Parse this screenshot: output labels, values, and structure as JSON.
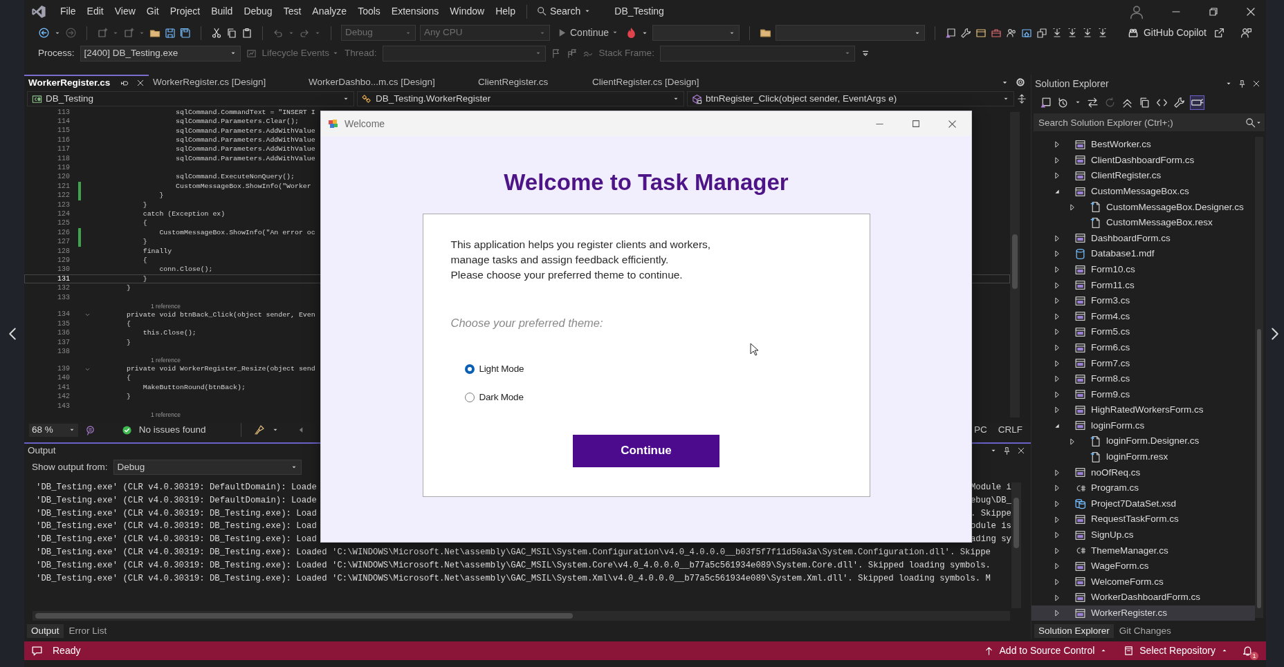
{
  "window": {
    "title": "DB_Testing"
  },
  "menu": [
    "File",
    "Edit",
    "View",
    "Git",
    "Project",
    "Build",
    "Debug",
    "Test",
    "Analyze",
    "Tools",
    "Extensions",
    "Window",
    "Help"
  ],
  "search": {
    "label": "Search"
  },
  "toolbar": {
    "dropdowns": [
      {
        "value": "Debug",
        "disabled": true
      },
      {
        "value": "Any CPU",
        "disabled": true
      }
    ],
    "continue": "Continue",
    "copilot": "GitHub Copilot"
  },
  "debug_bar": {
    "process_label": "Process:",
    "process": "[2400] DB_Testing.exe",
    "lifecycle_events": {
      "text": "Lifecycle Events",
      "disabled": true
    },
    "thread_label": {
      "text": "Thread:",
      "disabled": true
    },
    "stack_frame_label": {
      "text": "Stack Frame:",
      "disabled": true
    }
  },
  "document_tabs": [
    {
      "label": "WorkerRegister.cs",
      "selected": true
    },
    {
      "label": "WorkerRegister.cs [Design]",
      "selected": false
    },
    {
      "label": "WorkerDashbo...m.cs [Design]",
      "selected": false
    },
    {
      "label": "ClientRegister.cs",
      "selected": false
    },
    {
      "label": "ClientRegister.cs [Design]",
      "selected": false
    }
  ],
  "navigation_bar": [
    "DB_Testing",
    "DB_Testing.WorkerRegister",
    "btnRegister_Click(object sender, EventArgs e)"
  ],
  "code_lines": [
    {
      "kind": "code",
      "number": "113",
      "text": "            sqlCommand.CommandText = \"INSERT I",
      "changed": false,
      "current": false,
      "foldable": false
    },
    {
      "kind": "code",
      "number": "114",
      "text": "            sqlCommand.Parameters.Clear();",
      "changed": false,
      "current": false,
      "foldable": false
    },
    {
      "kind": "code",
      "number": "115",
      "text": "            sqlCommand.Parameters.AddWithValue",
      "changed": false,
      "current": false,
      "foldable": false
    },
    {
      "kind": "code",
      "number": "116",
      "text": "            sqlCommand.Parameters.AddWithValue",
      "changed": false,
      "current": false,
      "foldable": false
    },
    {
      "kind": "code",
      "number": "117",
      "text": "            sqlCommand.Parameters.AddWithValue",
      "changed": false,
      "current": false,
      "foldable": false
    },
    {
      "kind": "code",
      "number": "118",
      "text": "            sqlCommand.Parameters.AddWithValue",
      "changed": false,
      "current": false,
      "foldable": false
    },
    {
      "kind": "code",
      "number": "119",
      "changed": false,
      "current": false,
      "foldable": false
    },
    {
      "kind": "code",
      "number": "120",
      "text": "            sqlCommand.ExecuteNonQuery();",
      "changed": false,
      "current": false,
      "foldable": false
    },
    {
      "kind": "code",
      "number": "121",
      "text": "            CustomMessageBox.ShowInfo(\"Worker",
      "changed": true,
      "current": false,
      "foldable": false
    },
    {
      "kind": "code",
      "number": "122",
      "text": "        }",
      "changed": true,
      "current": false,
      "foldable": false
    },
    {
      "kind": "code",
      "number": "123",
      "text": "    }",
      "changed": false,
      "current": false,
      "foldable": false
    },
    {
      "kind": "code",
      "number": "124",
      "text": "    catch (Exception ex)",
      "changed": false,
      "current": false,
      "foldable": false
    },
    {
      "kind": "code",
      "number": "125",
      "text": "    {",
      "changed": false,
      "current": false,
      "foldable": false
    },
    {
      "kind": "code",
      "number": "126",
      "text": "        CustomMessageBox.ShowInfo(\"An error oc",
      "changed": true,
      "current": false,
      "foldable": false
    },
    {
      "kind": "code",
      "number": "127",
      "text": "    }",
      "changed": true,
      "current": false,
      "foldable": false
    },
    {
      "kind": "code",
      "number": "128",
      "text": "    finally",
      "changed": false,
      "current": false,
      "foldable": false
    },
    {
      "kind": "code",
      "number": "129",
      "text": "    {",
      "changed": false,
      "current": false,
      "foldable": false
    },
    {
      "kind": "code",
      "number": "130",
      "text": "        conn.Close();",
      "changed": false,
      "current": false,
      "foldable": false
    },
    {
      "kind": "code",
      "number": "131",
      "text": "    }",
      "changed": false,
      "current": true,
      "foldable": false
    },
    {
      "kind": "code",
      "number": "132",
      "text": "}",
      "changed": false,
      "current": false,
      "foldable": false
    },
    {
      "kind": "code",
      "number": "133",
      "changed": false,
      "current": false,
      "foldable": false
    },
    {
      "kind": "reference",
      "text": "1 reference"
    },
    {
      "kind": "code",
      "number": "134",
      "text": "private void btnBack_Click(object sender, Even",
      "changed": false,
      "current": false,
      "foldable": true
    },
    {
      "kind": "code",
      "number": "135",
      "text": "{",
      "changed": false,
      "current": false,
      "foldable": false
    },
    {
      "kind": "code",
      "number": "136",
      "text": "    this.Close();",
      "changed": false,
      "current": false,
      "foldable": false
    },
    {
      "kind": "code",
      "number": "137",
      "text": "}",
      "changed": false,
      "current": false,
      "foldable": false
    },
    {
      "kind": "code",
      "number": "138",
      "changed": false,
      "current": false,
      "foldable": false
    },
    {
      "kind": "reference",
      "text": "1 reference"
    },
    {
      "kind": "code",
      "number": "139",
      "text": "private void WorkerRegister_Resize(object send",
      "changed": false,
      "current": false,
      "foldable": true
    },
    {
      "kind": "code",
      "number": "140",
      "text": "{",
      "changed": false,
      "current": false,
      "foldable": false
    },
    {
      "kind": "code",
      "number": "141",
      "text": "    MakeButtonRound(btnBack);",
      "changed": false,
      "current": false,
      "foldable": false
    },
    {
      "kind": "code",
      "number": "142",
      "text": "}",
      "changed": false,
      "current": false,
      "foldable": false
    },
    {
      "kind": "code",
      "number": "143",
      "changed": false,
      "current": false,
      "foldable": false
    },
    {
      "kind": "reference",
      "text": "1 reference"
    }
  ],
  "editor_status": {
    "zoom": "68 %",
    "issues": "No issues found",
    "indicator": "PC",
    "line_ending": "CRLF"
  },
  "output": {
    "title": "Output",
    "show_from_label": "Show output from:",
    "source": "Debug",
    "lines": [
      {
        "text": "'DB_Testing.exe' (CLR v4.0.30319: DefaultDomain): Loade",
        "tail": "Module i"
      },
      {
        "text": "'DB_Testing.exe' (CLR v4.0.30319: DefaultDomain): Loade",
        "tail": "ebug\\DB_"
      },
      {
        "text": "'DB_Testing.exe' (CLR v4.0.30319: DB_Testing.exe): Load",
        "tail": ". Skippe"
      },
      {
        "text": "'DB_Testing.exe' (CLR v4.0.30319: DB_Testing.exe): Load",
        "tail": "odule is"
      },
      {
        "text": "'DB_Testing.exe' (CLR v4.0.30319: DB_Testing.exe): Load",
        "tail": "ading sy"
      },
      {
        "text": "'DB_Testing.exe' (CLR v4.0.30319: DB_Testing.exe): Loaded 'C:\\WINDOWS\\Microsoft.Net\\assembly\\GAC_MSIL\\System.Configuration\\v4.0_4.0.0.0__b03f5f7f11d50a3a\\System.Configuration.dll'. Skippe"
      },
      {
        "text": "'DB_Testing.exe' (CLR v4.0.30319: DB_Testing.exe): Loaded 'C:\\WINDOWS\\Microsoft.Net\\assembly\\GAC_MSIL\\System.Core\\v4.0_4.0.0.0__b77a5c561934e089\\System.Core.dll'. Skipped loading symbols."
      },
      {
        "text": "'DB_Testing.exe' (CLR v4.0.30319: DB_Testing.exe): Loaded 'C:\\WINDOWS\\Microsoft.Net\\assembly\\GAC_MSIL\\System.Xml\\v4.0_4.0.0.0__b77a5c561934e089\\System.Xml.dll'. Skipped loading symbols. M"
      }
    ],
    "tabs": [
      {
        "label": "Output",
        "selected": true
      },
      {
        "label": "Error List",
        "selected": false
      }
    ]
  },
  "solution_explorer": {
    "title": "Solution Explorer",
    "search": {
      "placeholder": "Search Solution Explorer (Ctrl+;)"
    },
    "items": [
      {
        "name": "BestWorker.cs",
        "kind": "form",
        "expanded": false,
        "selected": false
      },
      {
        "name": "ClientDashboardForm.cs",
        "kind": "form",
        "expanded": false,
        "selected": false
      },
      {
        "name": "ClientRegister.cs",
        "kind": "form",
        "expanded": false,
        "selected": false
      },
      {
        "name": "CustomMessageBox.cs",
        "kind": "form",
        "expanded": true,
        "selected": false,
        "children": [
          {
            "name": "CustomMessageBox.Designer.cs",
            "kind": "document",
            "expanded": false,
            "selected": false
          },
          {
            "name": "CustomMessageBox.resx",
            "kind": "document",
            "selected": false
          }
        ]
      },
      {
        "name": "DashboardForm.cs",
        "kind": "form",
        "expanded": false,
        "selected": false
      },
      {
        "name": "Database1.mdf",
        "kind": "database",
        "expanded": false,
        "selected": false
      },
      {
        "name": "Form10.cs",
        "kind": "form",
        "expanded": false,
        "selected": false
      },
      {
        "name": "Form11.cs",
        "kind": "form",
        "expanded": false,
        "selected": false
      },
      {
        "name": "Form3.cs",
        "kind": "form",
        "expanded": false,
        "selected": false
      },
      {
        "name": "Form4.cs",
        "kind": "form",
        "expanded": false,
        "selected": false
      },
      {
        "name": "Form5.cs",
        "kind": "form",
        "expanded": false,
        "selected": false
      },
      {
        "name": "Form6.cs",
        "kind": "form",
        "expanded": false,
        "selected": false
      },
      {
        "name": "Form7.cs",
        "kind": "form",
        "expanded": false,
        "selected": false
      },
      {
        "name": "Form8.cs",
        "kind": "form",
        "expanded": false,
        "selected": false
      },
      {
        "name": "Form9.cs",
        "kind": "form",
        "expanded": false,
        "selected": false
      },
      {
        "name": "HighRatedWorkersForm.cs",
        "kind": "form",
        "expanded": false,
        "selected": false
      },
      {
        "name": "loginForm.cs",
        "kind": "form",
        "expanded": true,
        "selected": false,
        "children": [
          {
            "name": "loginForm.Designer.cs",
            "kind": "document",
            "expanded": false,
            "selected": false
          },
          {
            "name": "loginForm.resx",
            "kind": "document",
            "selected": false
          }
        ]
      },
      {
        "name": "noOfReq.cs",
        "kind": "form",
        "expanded": false,
        "selected": false
      },
      {
        "name": "Program.cs",
        "kind": "csharp",
        "expanded": false,
        "selected": false
      },
      {
        "name": "Project7DataSet.xsd",
        "kind": "dataset",
        "expanded": false,
        "selected": false
      },
      {
        "name": "RequestTaskForm.cs",
        "kind": "form",
        "expanded": false,
        "selected": false
      },
      {
        "name": "SignUp.cs",
        "kind": "form",
        "expanded": false,
        "selected": false
      },
      {
        "name": "ThemeManager.cs",
        "kind": "csharp",
        "expanded": false,
        "selected": false
      },
      {
        "name": "WageForm.cs",
        "kind": "form",
        "expanded": false,
        "selected": false
      },
      {
        "name": "WelcomeForm.cs",
        "kind": "form",
        "expanded": false,
        "selected": false
      },
      {
        "name": "WorkerDashboardForm.cs",
        "kind": "form",
        "expanded": false,
        "selected": false
      },
      {
        "name": "WorkerRegister.cs",
        "kind": "form",
        "expanded": false,
        "selected": true
      }
    ],
    "tabs": [
      {
        "label": "Solution Explorer",
        "selected": true
      },
      {
        "label": "Git Changes",
        "selected": false
      }
    ]
  },
  "status_bar": {
    "message": "Ready",
    "source_control": "Add to Source Control",
    "repository": "Select Repository",
    "notifications": "1"
  },
  "dialog": {
    "title": "Welcome",
    "heading": "Welcome to Task Manager",
    "description": [
      "This application helps you register clients and workers,",
      "manage tasks and assign feedback efficiently.",
      "Please choose your preferred theme to continue."
    ],
    "prompt": "Choose your preferred theme:",
    "options": [
      {
        "label": "Light Mode",
        "selected": true
      },
      {
        "label": "Dark Mode",
        "selected": false
      }
    ],
    "button": "Continue"
  }
}
